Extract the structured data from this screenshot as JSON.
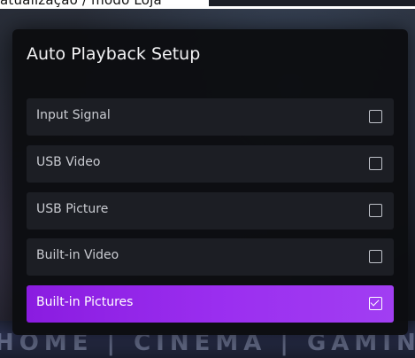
{
  "background": {
    "top_strip_text": "atualização / modo Loja",
    "banner_text": "HOME | CINEMA | GAMING | SPORTS | ROOM"
  },
  "dialog": {
    "title": "Auto Playback Setup",
    "options": [
      {
        "label": "Input Signal",
        "checked": false,
        "selected": false
      },
      {
        "label": "USB Video",
        "checked": false,
        "selected": false
      },
      {
        "label": "USB Picture",
        "checked": false,
        "selected": false
      },
      {
        "label": "Built-in Video",
        "checked": false,
        "selected": false
      },
      {
        "label": "Built-in Pictures",
        "checked": true,
        "selected": true
      }
    ]
  },
  "colors": {
    "dialog_bg": "#0c0d11",
    "option_bg": "#1c1e24",
    "accent_start": "#8a1ce0",
    "accent_end": "#a13ef2",
    "text": "#c9cbd1"
  },
  "icons": {
    "checkbox": "checkbox-icon"
  }
}
